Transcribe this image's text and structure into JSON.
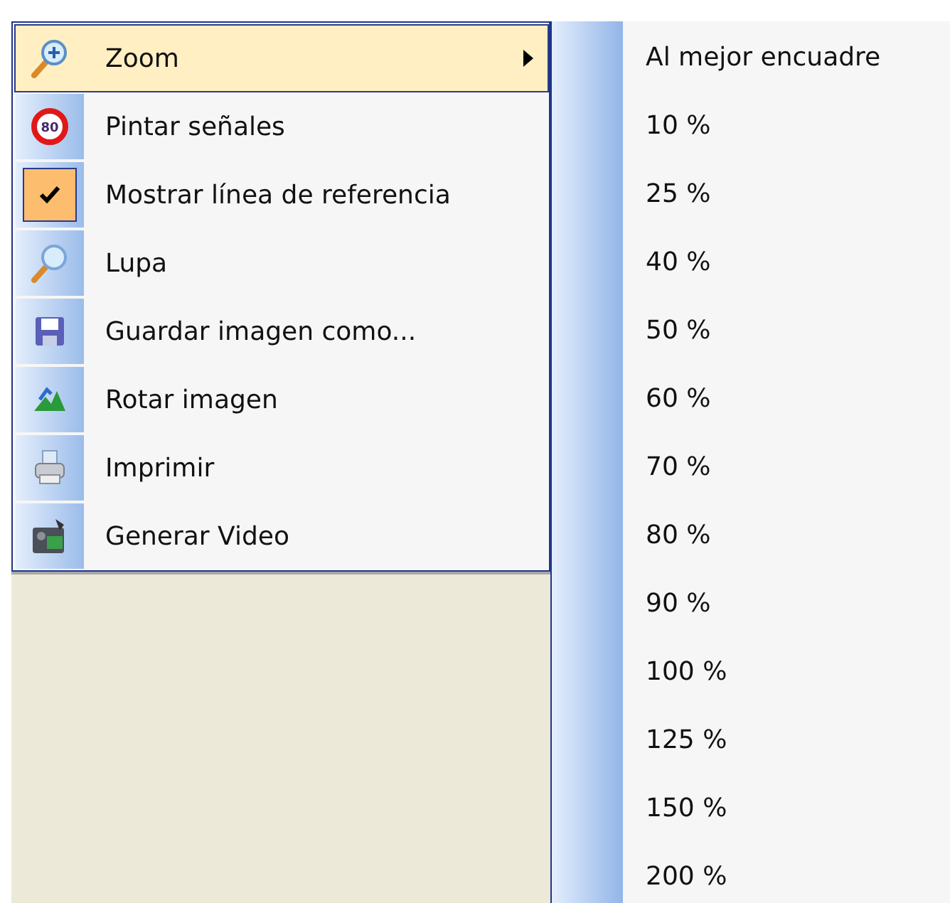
{
  "main_menu": {
    "items": [
      {
        "kind": "zoom",
        "label": "Zoom",
        "highlighted": true,
        "checked": false,
        "has_submenu": true
      },
      {
        "kind": "sign",
        "label": "Pintar señales",
        "highlighted": false,
        "checked": false,
        "has_submenu": false
      },
      {
        "kind": "check",
        "label": "Mostrar línea de referencia",
        "highlighted": false,
        "checked": true,
        "has_submenu": false
      },
      {
        "kind": "magnifier",
        "label": "Lupa",
        "highlighted": false,
        "checked": false,
        "has_submenu": false
      },
      {
        "kind": "save",
        "label": "Guardar imagen como...",
        "highlighted": false,
        "checked": false,
        "has_submenu": false
      },
      {
        "kind": "rotate",
        "label": "Rotar imagen",
        "highlighted": false,
        "checked": false,
        "has_submenu": false
      },
      {
        "kind": "print",
        "label": "Imprimir",
        "highlighted": false,
        "checked": false,
        "has_submenu": false
      },
      {
        "kind": "video",
        "label": "Generar Video",
        "highlighted": false,
        "checked": false,
        "has_submenu": false
      }
    ]
  },
  "sign_icon_text": "80",
  "zoom_submenu": {
    "items": [
      {
        "label": "Al mejor encuadre"
      },
      {
        "label": "10 %"
      },
      {
        "label": "25 %"
      },
      {
        "label": "40 %"
      },
      {
        "label": "50 %"
      },
      {
        "label": "60 %"
      },
      {
        "label": "70 %"
      },
      {
        "label": "80 %"
      },
      {
        "label": "90 %"
      },
      {
        "label": "100 %"
      },
      {
        "label": "125 %"
      },
      {
        "label": "150 %"
      },
      {
        "label": "200 %"
      }
    ]
  }
}
